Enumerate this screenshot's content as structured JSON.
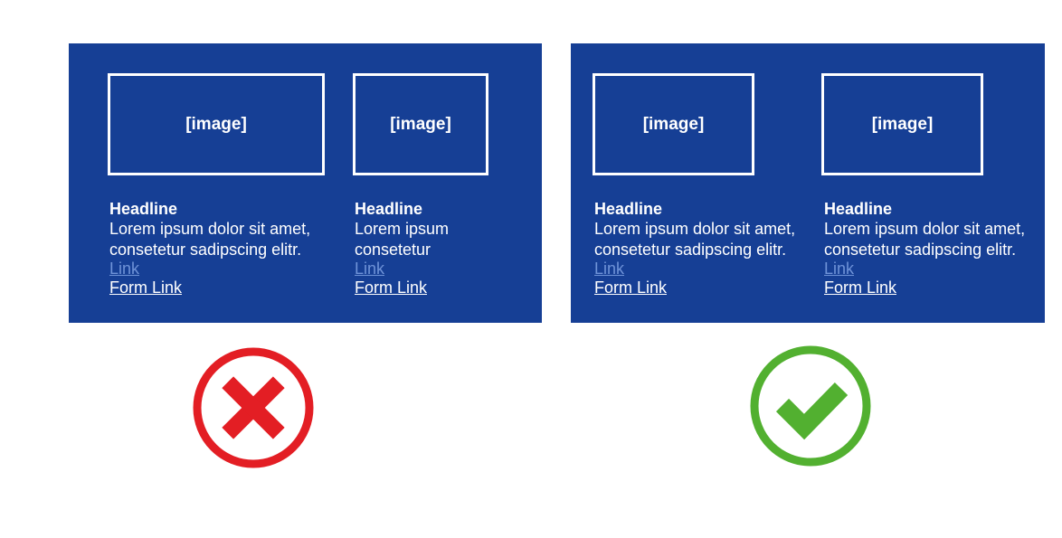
{
  "wrong_example": {
    "cards": [
      {
        "image_label": "[image]",
        "headline": "Headline",
        "body": "Lorem ipsum dolor sit amet,\nconsetetur sadipscing elitr.",
        "link": "Link",
        "form_link": "Form Link"
      },
      {
        "image_label": "[image]",
        "headline": "Headline",
        "body": "Lorem ipsum\nconsetetur",
        "link": "Link",
        "form_link": "Form Link"
      }
    ],
    "status_icon": "cross-icon",
    "status_color": "#e31e24"
  },
  "right_example": {
    "cards": [
      {
        "image_label": "[image]",
        "headline": "Headline",
        "body": "Lorem ipsum dolor sit amet,\nconsetetur sadipscing elitr.",
        "link": "Link",
        "form_link": "Form Link"
      },
      {
        "image_label": "[image]",
        "headline": "Headline",
        "body": "Lorem ipsum dolor sit amet,\nconsetetur sadipscing elitr.",
        "link": "Link",
        "form_link": "Form Link"
      }
    ],
    "status_icon": "checkmark-icon",
    "status_color": "#52b030"
  },
  "colors": {
    "panel_background": "#163f95",
    "link": "#6f93d8",
    "text": "#ffffff"
  }
}
